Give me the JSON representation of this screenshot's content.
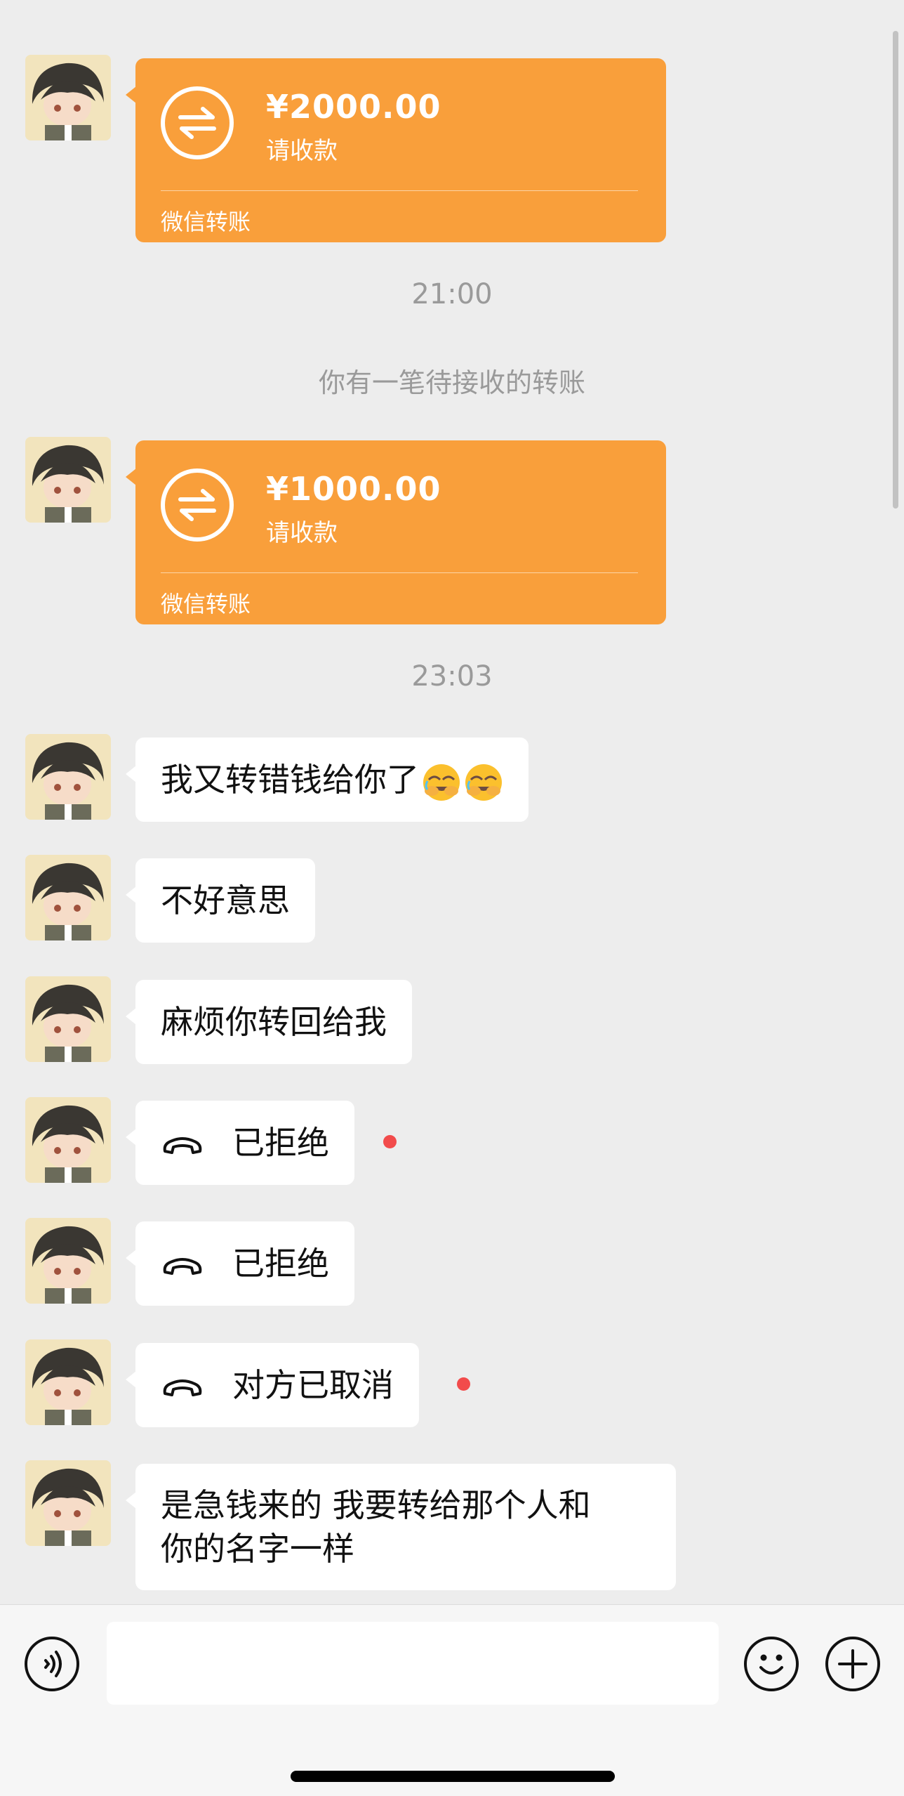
{
  "messages": {
    "transfer1": {
      "amount": "¥2000.00",
      "note": "请收款",
      "brand": "微信转账"
    },
    "time1": "21:00",
    "system1": "你有一笔待接收的转账",
    "transfer2": {
      "amount": "¥1000.00",
      "note": "请收款",
      "brand": "微信转账"
    },
    "time2": "23:03",
    "text1": "我又转错钱给你了",
    "text2": "不好意思",
    "text3": "麻烦你转回给我",
    "call1": "已拒绝",
    "call2": "已拒绝",
    "call3": "对方已取消",
    "text4_line1": "是急钱来的 我要转给那个人和",
    "text4_line2": "你的名字一样"
  },
  "icons": {
    "transfer": "transfer-arrows-icon",
    "emoji": "facepalm-laughing-emoji",
    "call": "phone-hangup-icon",
    "voice": "voice-icon",
    "emoji_button": "smiley-icon",
    "plus": "plus-icon"
  },
  "colors": {
    "transfer_bg": "#f99f3b",
    "unread_dot": "#f24b4b",
    "chat_bg": "#ededed"
  }
}
